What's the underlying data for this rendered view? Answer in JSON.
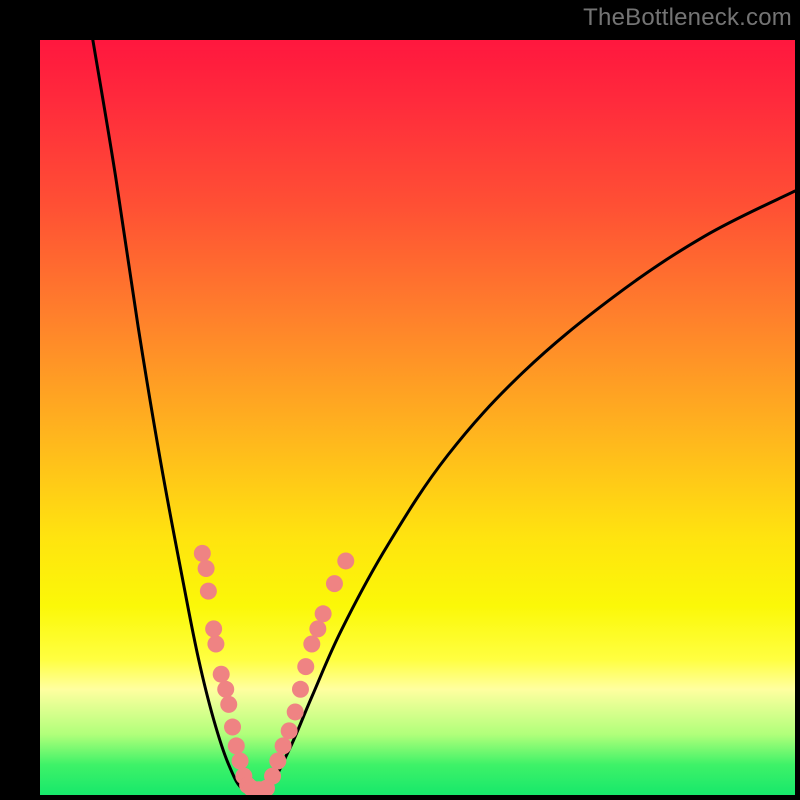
{
  "watermark_text": "TheBottleneck.com",
  "chart_data": {
    "type": "line",
    "title": "",
    "xlabel": "",
    "ylabel": "",
    "xlim": [
      0,
      100
    ],
    "ylim": [
      0,
      100
    ],
    "gradient_stops": [
      {
        "pct": 0,
        "color": "#ff173e"
      },
      {
        "pct": 8,
        "color": "#ff2a3c"
      },
      {
        "pct": 22,
        "color": "#ff5034"
      },
      {
        "pct": 36,
        "color": "#ff7e2c"
      },
      {
        "pct": 52,
        "color": "#ffb41e"
      },
      {
        "pct": 66,
        "color": "#ffe40f"
      },
      {
        "pct": 75,
        "color": "#fbf808"
      },
      {
        "pct": 82,
        "color": "#ffff40"
      },
      {
        "pct": 86,
        "color": "#ffffa0"
      },
      {
        "pct": 92,
        "color": "#b0ff7a"
      },
      {
        "pct": 96,
        "color": "#3ef268"
      },
      {
        "pct": 100,
        "color": "#17e86b"
      }
    ],
    "series": [
      {
        "name": "left_branch",
        "x": [
          7.0,
          10.0,
          13.0,
          16.0,
          19.0,
          21.0,
          23.0,
          25.0,
          27.0
        ],
        "y": [
          100.0,
          82.0,
          62.0,
          44.0,
          28.0,
          18.0,
          10.0,
          4.0,
          0.7
        ]
      },
      {
        "name": "right_branch",
        "x": [
          30.0,
          33.0,
          36.0,
          40.0,
          46.0,
          54.0,
          64.0,
          76.0,
          88.0,
          100.0
        ],
        "y": [
          0.7,
          6.0,
          13.0,
          22.0,
          33.0,
          45.0,
          56.0,
          66.0,
          74.0,
          80.0
        ]
      },
      {
        "name": "valley_floor",
        "x": [
          27.0,
          30.0
        ],
        "y": [
          0.7,
          0.7
        ]
      }
    ],
    "marker_points": {
      "name": "highlight_dots",
      "color": "#ef8383",
      "points": [
        {
          "x": 21.5,
          "y": 32.0
        },
        {
          "x": 22.0,
          "y": 30.0
        },
        {
          "x": 22.3,
          "y": 27.0
        },
        {
          "x": 23.0,
          "y": 22.0
        },
        {
          "x": 23.3,
          "y": 20.0
        },
        {
          "x": 24.0,
          "y": 16.0
        },
        {
          "x": 24.6,
          "y": 14.0
        },
        {
          "x": 25.0,
          "y": 12.0
        },
        {
          "x": 25.5,
          "y": 9.0
        },
        {
          "x": 26.0,
          "y": 6.5
        },
        {
          "x": 26.5,
          "y": 4.5
        },
        {
          "x": 27.0,
          "y": 2.5
        },
        {
          "x": 27.5,
          "y": 1.3
        },
        {
          "x": 28.0,
          "y": 0.9
        },
        {
          "x": 29.0,
          "y": 0.7
        },
        {
          "x": 30.0,
          "y": 0.9
        },
        {
          "x": 30.8,
          "y": 2.5
        },
        {
          "x": 31.5,
          "y": 4.5
        },
        {
          "x": 32.2,
          "y": 6.5
        },
        {
          "x": 33.0,
          "y": 8.5
        },
        {
          "x": 33.8,
          "y": 11.0
        },
        {
          "x": 34.5,
          "y": 14.0
        },
        {
          "x": 35.2,
          "y": 17.0
        },
        {
          "x": 36.0,
          "y": 20.0
        },
        {
          "x": 36.8,
          "y": 22.0
        },
        {
          "x": 37.5,
          "y": 24.0
        },
        {
          "x": 39.0,
          "y": 28.0
        },
        {
          "x": 40.5,
          "y": 31.0
        }
      ]
    }
  }
}
